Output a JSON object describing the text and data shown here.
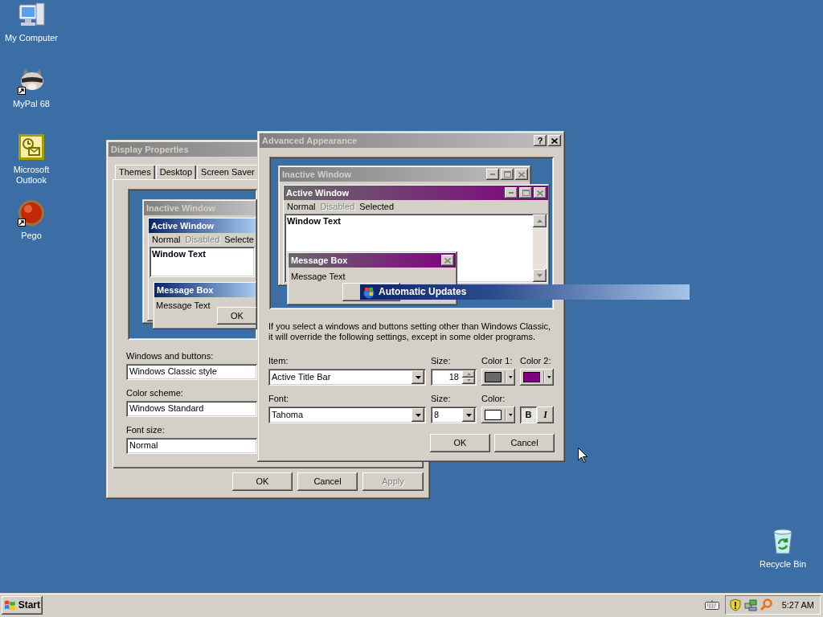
{
  "desktop_icons": [
    {
      "label": "My Computer",
      "kind": "computer",
      "shortcut": false
    },
    {
      "label": "MyPal 68",
      "kind": "raccoon",
      "shortcut": true
    },
    {
      "label": "Microsoft Outlook",
      "kind": "outlook",
      "shortcut": false
    },
    {
      "label": "Pego",
      "kind": "ball",
      "shortcut": true
    }
  ],
  "recycle_bin": {
    "label": "Recycle Bin"
  },
  "display_properties": {
    "title": "Display Properties",
    "active": false,
    "tabs": [
      {
        "label": "Themes",
        "selected": false
      },
      {
        "label": "Desktop",
        "selected": false
      },
      {
        "label": "Screen Saver",
        "selected": false
      }
    ],
    "preview": {
      "inactive_title": "Inactive Window",
      "active_title": "Active Window",
      "menu": [
        {
          "label": "Normal",
          "disabled": false
        },
        {
          "label": "Disabled",
          "disabled": true
        },
        {
          "label": "Selecte",
          "disabled": false
        }
      ],
      "window_text": "Window Text",
      "message_box_title": "Message Box",
      "message_text": "Message Text",
      "button": "OK"
    },
    "fields": [
      {
        "label": "Windows and buttons:",
        "value": "Windows Classic style"
      },
      {
        "label": "Color scheme:",
        "value": "Windows Standard"
      },
      {
        "label": "Font size:",
        "value": "Normal"
      }
    ],
    "buttons": [
      {
        "label": "OK",
        "disabled": false
      },
      {
        "label": "Cancel",
        "disabled": false
      },
      {
        "label": "Apply",
        "disabled": true
      }
    ]
  },
  "advanced_appearance": {
    "title": "Advanced Appearance",
    "active": false,
    "help_button": "?",
    "preview": {
      "inactive_title": "Inactive Window",
      "active_title": "Active Window",
      "menu": [
        {
          "label": "Normal",
          "disabled": false
        },
        {
          "label": "Disabled",
          "disabled": true
        },
        {
          "label": "Selected",
          "disabled": false
        }
      ],
      "window_text": "Window Text",
      "message_box_title": "Message Box",
      "message_text": "Message Text"
    },
    "notice": "If you select a windows and buttons setting other than Windows Classic,\nit will override the following settings, except in some older programs.",
    "item": {
      "label": "Item:",
      "value": "Active Title Bar"
    },
    "item_size": {
      "label": "Size:",
      "value": "18"
    },
    "color_1": {
      "label": "Color 1:",
      "color": "#696969"
    },
    "color_2": {
      "label": "Color 2:",
      "color": "#800080"
    },
    "font": {
      "label": "Font:",
      "value": "Tahoma"
    },
    "font_size": {
      "label": "Size:",
      "value": "8"
    },
    "font_color": {
      "label": "Color:",
      "color": "#ffffff"
    },
    "bold": {
      "label": "B",
      "selected": true
    },
    "italic": {
      "label": "I",
      "selected": false
    },
    "buttons": [
      {
        "label": "OK"
      },
      {
        "label": "Cancel"
      }
    ]
  },
  "notification": {
    "title": "Automatic Updates"
  },
  "taskbar": {
    "start": "Start",
    "clock": "5:27 AM"
  }
}
